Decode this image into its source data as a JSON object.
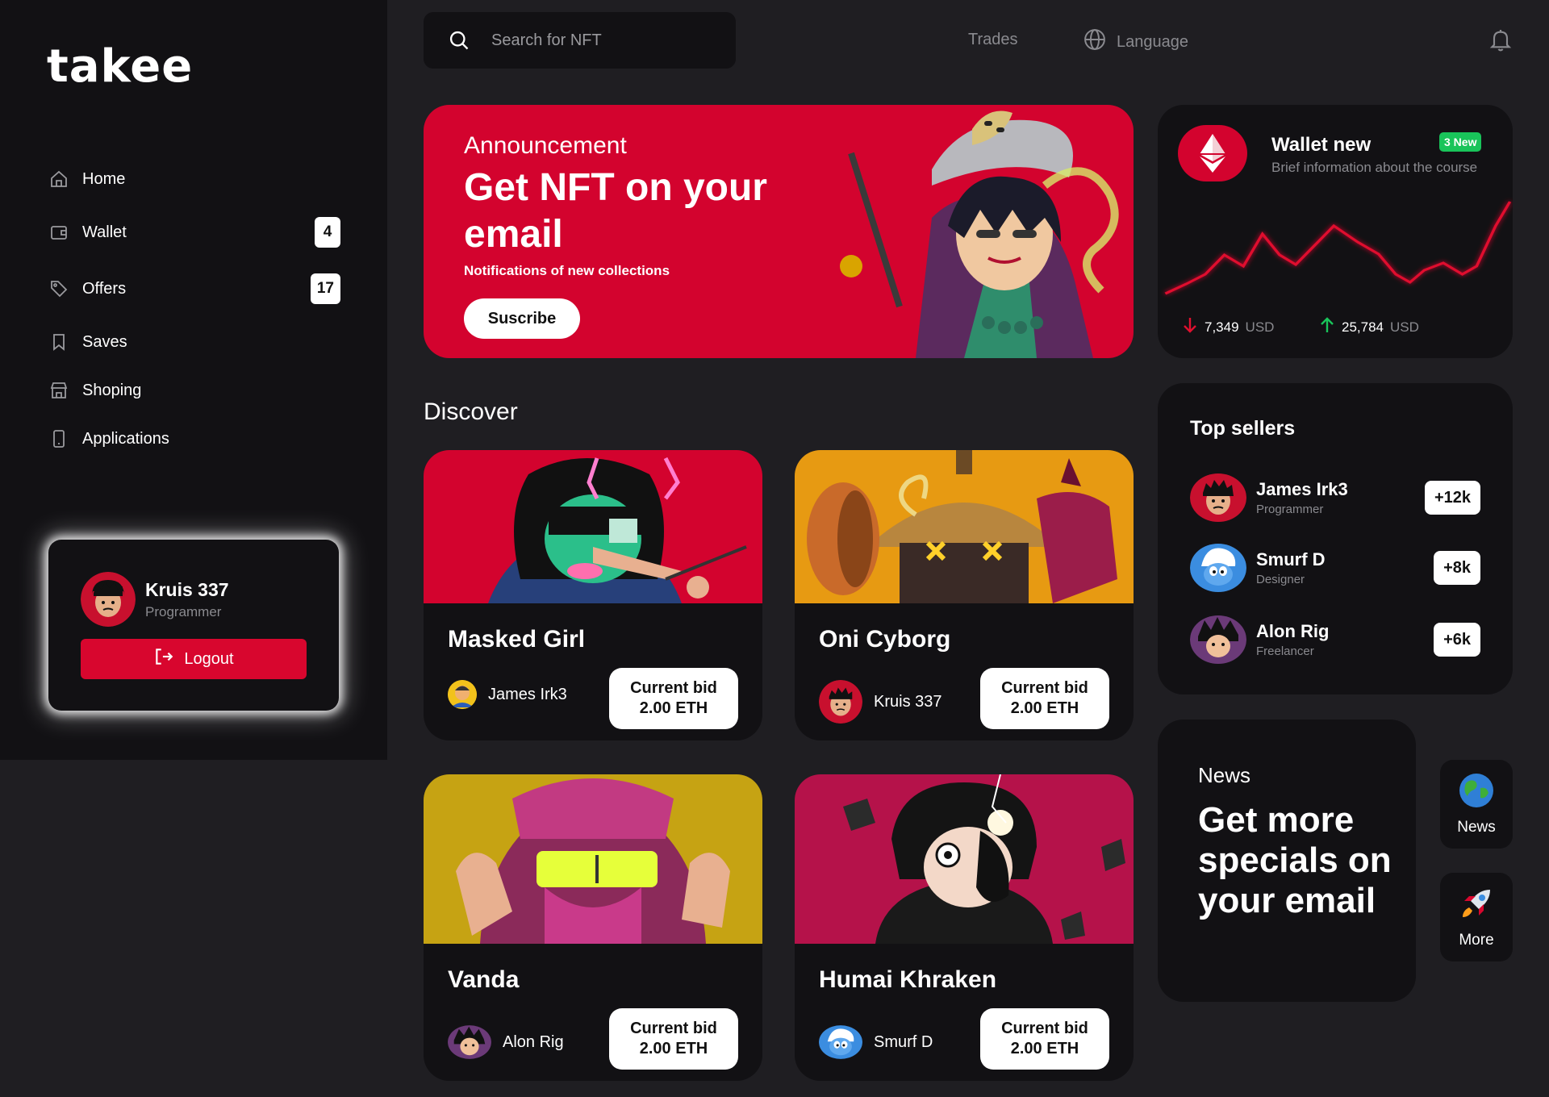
{
  "app": {
    "logo": "takee"
  },
  "sidebar": {
    "items": [
      {
        "label": "Home",
        "icon": "home-icon"
      },
      {
        "label": "Wallet",
        "icon": "wallet-icon",
        "badge": "4"
      },
      {
        "label": "Offers",
        "icon": "tag-icon",
        "badge": "17"
      },
      {
        "label": "Saves",
        "icon": "bookmark-icon"
      },
      {
        "label": "Shoping",
        "icon": "store-icon"
      },
      {
        "label": "Applications",
        "icon": "phone-icon"
      }
    ],
    "profile": {
      "name": "Kruis 337",
      "role": "Programmer",
      "logout_label": "Logout"
    }
  },
  "header": {
    "search_placeholder": "Search for NFT",
    "trades_label": "Trades",
    "language_label": "Language"
  },
  "banner": {
    "kicker": "Announcement",
    "headline": "Get NFT on your email",
    "subtext": "Notifications of new collections",
    "cta_label": "Suscribe"
  },
  "wallet": {
    "title": "Wallet new",
    "badge": "3 New",
    "subtitle": "Brief information about the course",
    "down_value": "7,349",
    "up_value": "25,784",
    "currency": "USD",
    "accent": "#d3032e",
    "up_color": "#19c45a"
  },
  "discover": {
    "title": "Discover",
    "bid_label": "Current bid",
    "cards": [
      {
        "title": "Masked Girl",
        "owner": "James Irk3",
        "bid": "2.00 ETH"
      },
      {
        "title": "Oni Cyborg",
        "owner": "Kruis 337",
        "bid": "2.00 ETH"
      },
      {
        "title": "Vanda",
        "owner": "Alon Rig",
        "bid": "2.00 ETH"
      },
      {
        "title": "Humai Khraken",
        "owner": "Smurf D",
        "bid": "2.00 ETH"
      }
    ]
  },
  "top_sellers": {
    "title": "Top sellers",
    "sellers": [
      {
        "name": "James Irk3",
        "role": "Programmer",
        "delta": "+12k"
      },
      {
        "name": "Smurf D",
        "role": "Designer",
        "delta": "+8k"
      },
      {
        "name": "Alon Rig",
        "role": "Freelancer",
        "delta": "+6k"
      }
    ]
  },
  "news": {
    "kicker": "News",
    "headline": "Get more specials on your email",
    "tiles": [
      {
        "label": "News",
        "icon": "globe-icon"
      },
      {
        "label": "More",
        "icon": "rocket-icon"
      }
    ]
  }
}
